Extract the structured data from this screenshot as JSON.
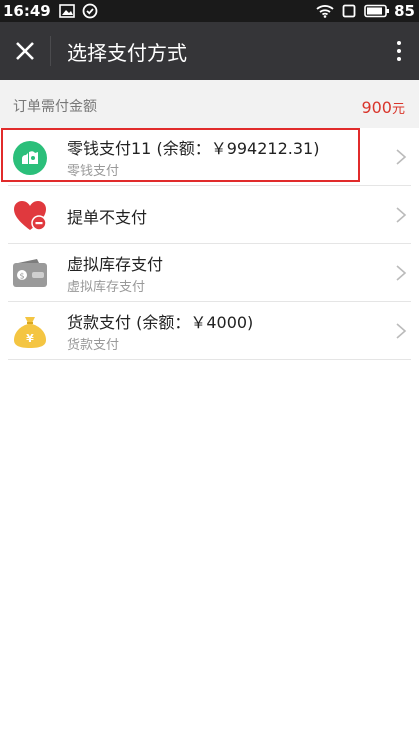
{
  "status_bar": {
    "time": "16:49",
    "battery": "85",
    "icons": [
      "image-icon",
      "check-circle-icon",
      "wifi-icon",
      "sim-icon",
      "battery-icon"
    ]
  },
  "app_bar": {
    "title": "选择支付方式",
    "close_icon": "close-icon",
    "more_icon": "more-vertical-icon"
  },
  "order": {
    "label": "订单需付金额",
    "amount": "900",
    "unit": "元",
    "amount_color": "#d9352b"
  },
  "payment_methods": [
    {
      "title": "零钱支付11 (余额：￥994212.31)",
      "subtitle": "零钱支付",
      "icon": "wallet-change-icon",
      "icon_color": "#2bbf7a",
      "selected": true
    },
    {
      "title": "提单不支付",
      "subtitle": "",
      "icon": "heart-minus-icon",
      "icon_color": "#e0393e"
    },
    {
      "title": "虚拟库存支付",
      "subtitle": "虚拟库存支付",
      "icon": "wallet-icon",
      "icon_color": "#9a9a9a"
    },
    {
      "title": "货款支付 (余额：￥4000)",
      "subtitle": "货款支付",
      "icon": "money-bag-icon",
      "icon_color": "#f4c542"
    }
  ],
  "colors": {
    "status_bar": "#1a1a1a",
    "app_bar": "#353538",
    "highlight_border": "#e12b2b"
  }
}
